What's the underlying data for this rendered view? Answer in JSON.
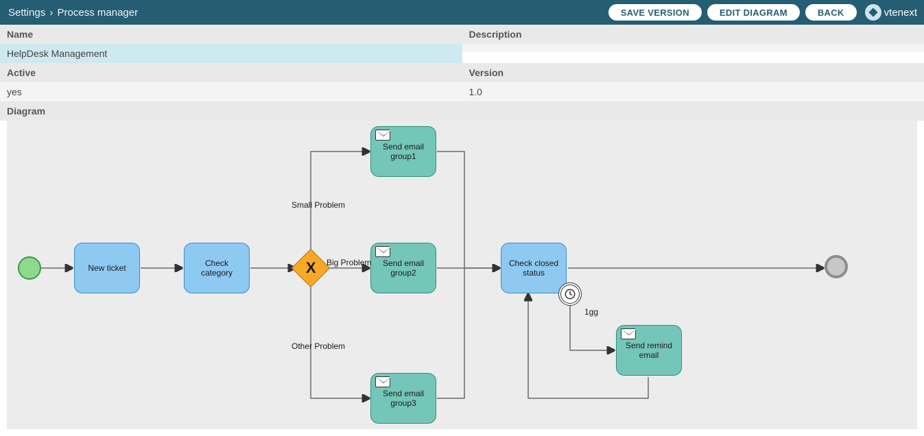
{
  "breadcrumb": {
    "root": "Settings",
    "current": "Process manager"
  },
  "header": {
    "save_label": "SAVE VERSION",
    "edit_label": "EDIT DIAGRAM",
    "back_label": "BACK",
    "brand": "vtenext"
  },
  "fields": {
    "name_label": "Name",
    "name_value": "HelpDesk Management",
    "description_label": "Description",
    "description_value": "",
    "active_label": "Active",
    "active_value": "yes",
    "version_label": "Version",
    "version_value": "1.0",
    "diagram_label": "Diagram"
  },
  "diagram": {
    "tasks": {
      "new_ticket": "New ticket",
      "check_category": "Check category",
      "send_email_g1": "Send email group1",
      "send_email_g2": "Send email group2",
      "send_email_g3": "Send email group3",
      "check_closed": "Check closed status",
      "send_remind": "Send remind email"
    },
    "edge_labels": {
      "small": "Small Problem",
      "big": "Big Problem",
      "other": "Other Problem",
      "timer": "1gg"
    }
  }
}
